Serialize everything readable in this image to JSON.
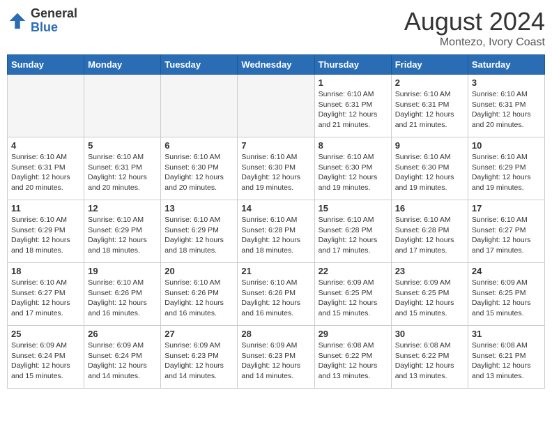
{
  "header": {
    "logo_general": "General",
    "logo_blue": "Blue",
    "month_year": "August 2024",
    "location": "Montezo, Ivory Coast"
  },
  "days_of_week": [
    "Sunday",
    "Monday",
    "Tuesday",
    "Wednesday",
    "Thursday",
    "Friday",
    "Saturday"
  ],
  "weeks": [
    [
      {
        "day": "",
        "info": ""
      },
      {
        "day": "",
        "info": ""
      },
      {
        "day": "",
        "info": ""
      },
      {
        "day": "",
        "info": ""
      },
      {
        "day": "1",
        "info": "Sunrise: 6:10 AM\nSunset: 6:31 PM\nDaylight: 12 hours and 21 minutes."
      },
      {
        "day": "2",
        "info": "Sunrise: 6:10 AM\nSunset: 6:31 PM\nDaylight: 12 hours and 21 minutes."
      },
      {
        "day": "3",
        "info": "Sunrise: 6:10 AM\nSunset: 6:31 PM\nDaylight: 12 hours and 20 minutes."
      }
    ],
    [
      {
        "day": "4",
        "info": "Sunrise: 6:10 AM\nSunset: 6:31 PM\nDaylight: 12 hours and 20 minutes."
      },
      {
        "day": "5",
        "info": "Sunrise: 6:10 AM\nSunset: 6:31 PM\nDaylight: 12 hours and 20 minutes."
      },
      {
        "day": "6",
        "info": "Sunrise: 6:10 AM\nSunset: 6:30 PM\nDaylight: 12 hours and 20 minutes."
      },
      {
        "day": "7",
        "info": "Sunrise: 6:10 AM\nSunset: 6:30 PM\nDaylight: 12 hours and 19 minutes."
      },
      {
        "day": "8",
        "info": "Sunrise: 6:10 AM\nSunset: 6:30 PM\nDaylight: 12 hours and 19 minutes."
      },
      {
        "day": "9",
        "info": "Sunrise: 6:10 AM\nSunset: 6:30 PM\nDaylight: 12 hours and 19 minutes."
      },
      {
        "day": "10",
        "info": "Sunrise: 6:10 AM\nSunset: 6:29 PM\nDaylight: 12 hours and 19 minutes."
      }
    ],
    [
      {
        "day": "11",
        "info": "Sunrise: 6:10 AM\nSunset: 6:29 PM\nDaylight: 12 hours and 18 minutes."
      },
      {
        "day": "12",
        "info": "Sunrise: 6:10 AM\nSunset: 6:29 PM\nDaylight: 12 hours and 18 minutes."
      },
      {
        "day": "13",
        "info": "Sunrise: 6:10 AM\nSunset: 6:29 PM\nDaylight: 12 hours and 18 minutes."
      },
      {
        "day": "14",
        "info": "Sunrise: 6:10 AM\nSunset: 6:28 PM\nDaylight: 12 hours and 18 minutes."
      },
      {
        "day": "15",
        "info": "Sunrise: 6:10 AM\nSunset: 6:28 PM\nDaylight: 12 hours and 17 minutes."
      },
      {
        "day": "16",
        "info": "Sunrise: 6:10 AM\nSunset: 6:28 PM\nDaylight: 12 hours and 17 minutes."
      },
      {
        "day": "17",
        "info": "Sunrise: 6:10 AM\nSunset: 6:27 PM\nDaylight: 12 hours and 17 minutes."
      }
    ],
    [
      {
        "day": "18",
        "info": "Sunrise: 6:10 AM\nSunset: 6:27 PM\nDaylight: 12 hours and 17 minutes."
      },
      {
        "day": "19",
        "info": "Sunrise: 6:10 AM\nSunset: 6:26 PM\nDaylight: 12 hours and 16 minutes."
      },
      {
        "day": "20",
        "info": "Sunrise: 6:10 AM\nSunset: 6:26 PM\nDaylight: 12 hours and 16 minutes."
      },
      {
        "day": "21",
        "info": "Sunrise: 6:10 AM\nSunset: 6:26 PM\nDaylight: 12 hours and 16 minutes."
      },
      {
        "day": "22",
        "info": "Sunrise: 6:09 AM\nSunset: 6:25 PM\nDaylight: 12 hours and 15 minutes."
      },
      {
        "day": "23",
        "info": "Sunrise: 6:09 AM\nSunset: 6:25 PM\nDaylight: 12 hours and 15 minutes."
      },
      {
        "day": "24",
        "info": "Sunrise: 6:09 AM\nSunset: 6:25 PM\nDaylight: 12 hours and 15 minutes."
      }
    ],
    [
      {
        "day": "25",
        "info": "Sunrise: 6:09 AM\nSunset: 6:24 PM\nDaylight: 12 hours and 15 minutes."
      },
      {
        "day": "26",
        "info": "Sunrise: 6:09 AM\nSunset: 6:24 PM\nDaylight: 12 hours and 14 minutes."
      },
      {
        "day": "27",
        "info": "Sunrise: 6:09 AM\nSunset: 6:23 PM\nDaylight: 12 hours and 14 minutes."
      },
      {
        "day": "28",
        "info": "Sunrise: 6:09 AM\nSunset: 6:23 PM\nDaylight: 12 hours and 14 minutes."
      },
      {
        "day": "29",
        "info": "Sunrise: 6:08 AM\nSunset: 6:22 PM\nDaylight: 12 hours and 13 minutes."
      },
      {
        "day": "30",
        "info": "Sunrise: 6:08 AM\nSunset: 6:22 PM\nDaylight: 12 hours and 13 minutes."
      },
      {
        "day": "31",
        "info": "Sunrise: 6:08 AM\nSunset: 6:21 PM\nDaylight: 12 hours and 13 minutes."
      }
    ]
  ]
}
